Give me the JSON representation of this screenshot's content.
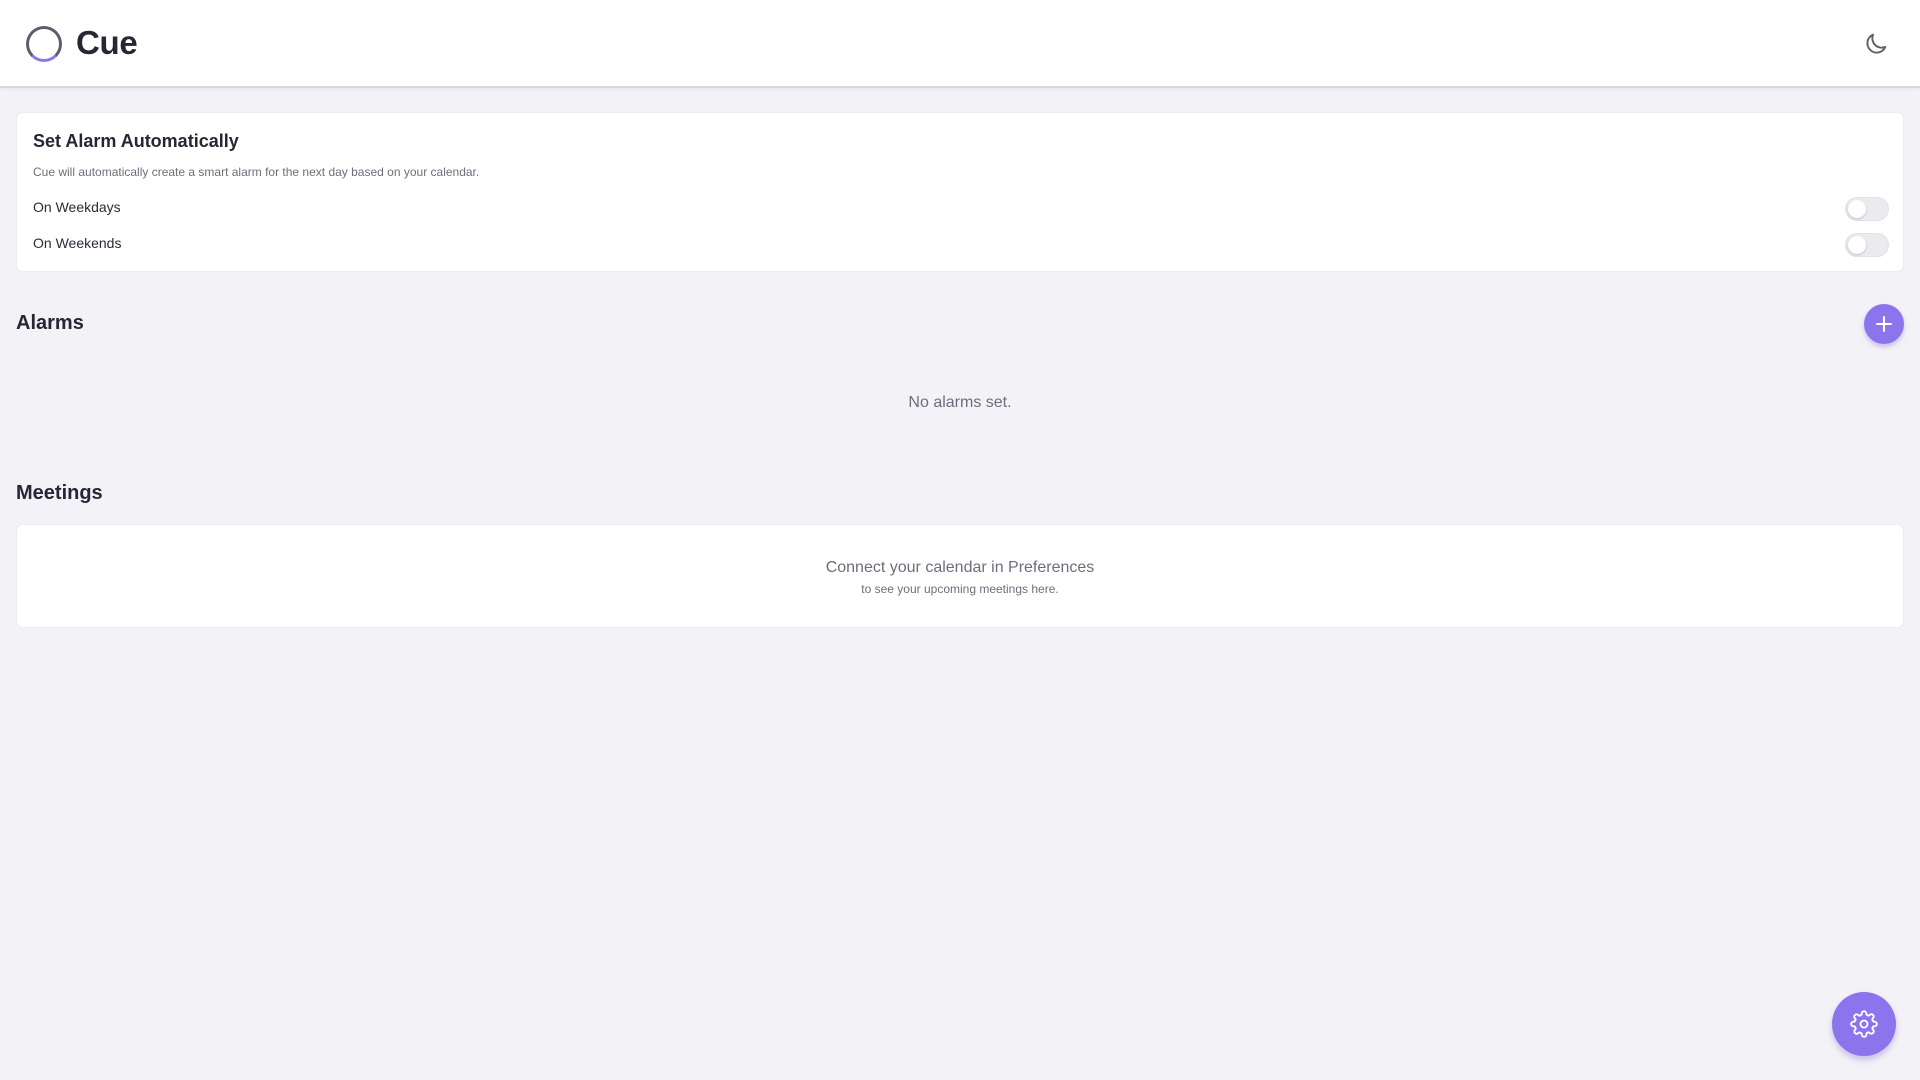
{
  "app": {
    "title": "Cue"
  },
  "header": {
    "theme_icon": "moon-icon"
  },
  "auto_alarm": {
    "title": "Set Alarm Automatically",
    "description": "Cue will automatically create a smart alarm for the next day based on your calendar.",
    "options": [
      {
        "label": "On Weekdays",
        "enabled": false
      },
      {
        "label": "On Weekends",
        "enabled": false
      }
    ]
  },
  "alarms": {
    "title": "Alarms",
    "add_icon": "plus-icon",
    "empty_text": "No alarms set."
  },
  "meetings": {
    "title": "Meetings",
    "message": "Connect your calendar in Preferences",
    "submessage": "to see your upcoming meetings here."
  },
  "settings": {
    "icon": "gear-icon"
  },
  "colors": {
    "accent": "#8c74ec",
    "background": "#f3f2f7",
    "card": "#ffffff",
    "text": "#262634",
    "muted": "#6e6d7c"
  }
}
